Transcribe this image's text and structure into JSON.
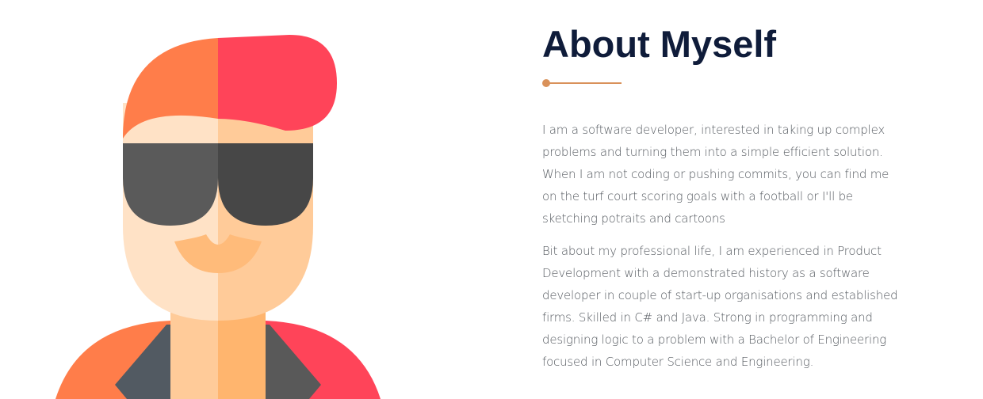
{
  "about": {
    "title": "About Myself",
    "paragraph1": "I am a software developer, interested in taking up complex problems and turning them into a simple efficient solution. When I am not coding or pushing commits, you can find me on the turf court scoring goals with a football or I'll be sketching potraits and cartoons",
    "paragraph2": "Bit about my professional life, I am experienced in Product Development with a demonstrated history as a software developer in couple of start-up organisations and established firms. Skilled in C# and Java. Strong in programming and designing logic to a problem with a Bachelor of Engineering focused in Computer Science and Engineering."
  },
  "colors": {
    "title": "#0f1c3a",
    "accent": "#d9915a",
    "body_text": "#555a60",
    "hair_left": "#ff7d4a",
    "hair_right": "#ff4459",
    "skin_light": "#ffe2c6",
    "skin_dark": "#ffcb99",
    "glasses_left": "#5a5a5a",
    "glasses_right": "#474747"
  },
  "icons": {
    "avatar": "cartoon-developer-avatar-icon"
  }
}
